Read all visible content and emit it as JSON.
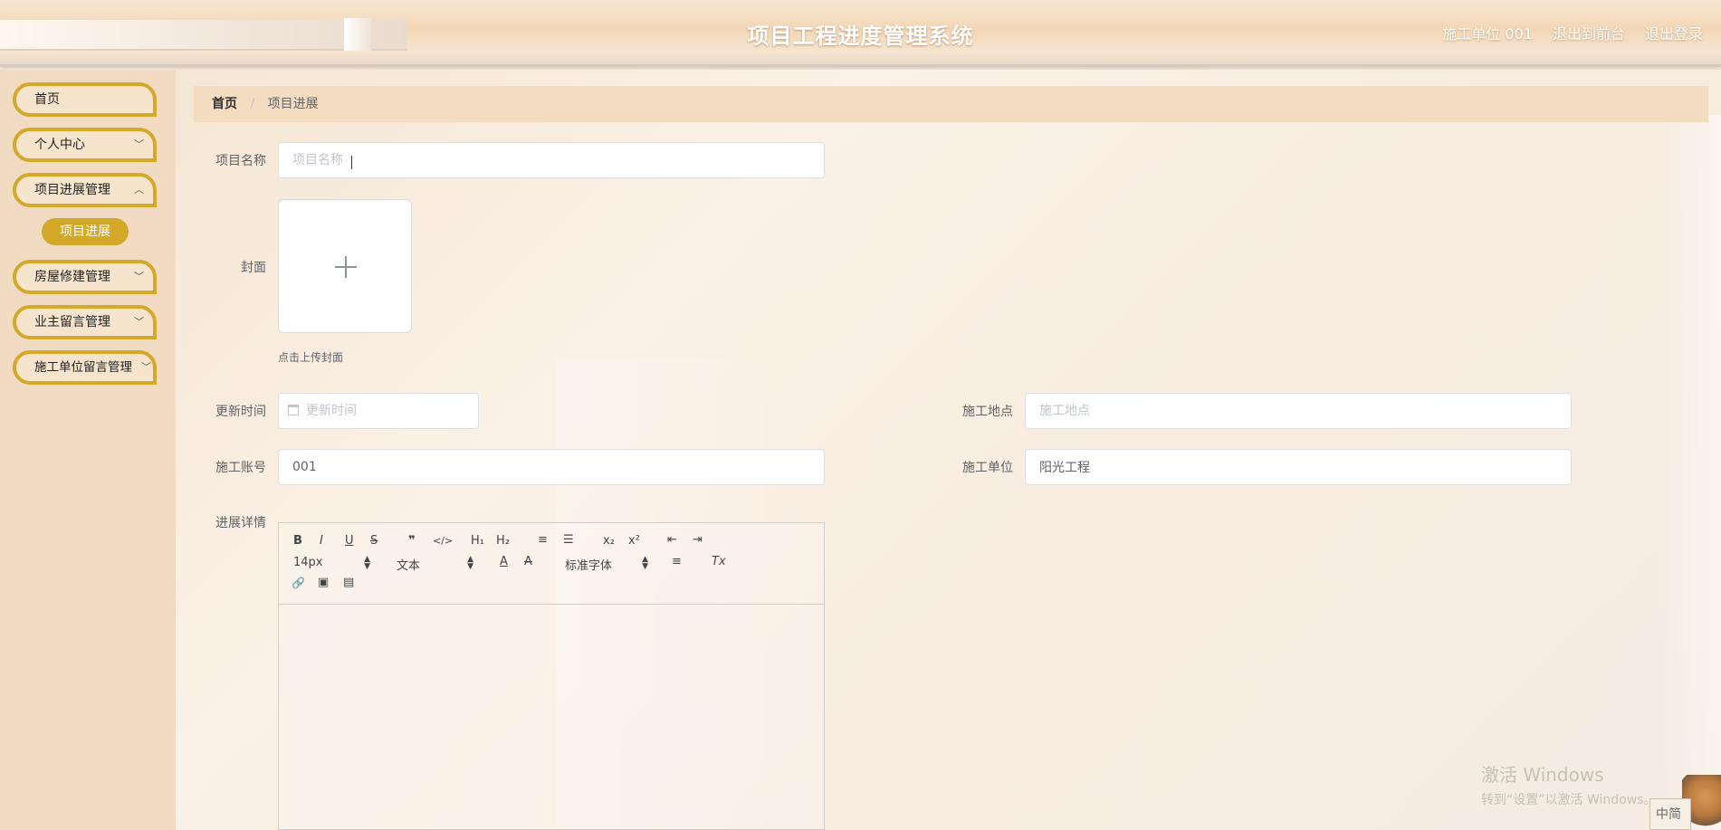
{
  "header": {
    "title": "项目工程进度管理系统",
    "user": "施工单位 001",
    "back_to_front": "退出到前台",
    "logout": "退出登录"
  },
  "sidebar": {
    "items": [
      {
        "label": "首页",
        "has_chevron": false
      },
      {
        "label": "个人中心",
        "has_chevron": true
      },
      {
        "label": "项目进展管理",
        "has_chevron": true
      },
      {
        "label": "房屋修建管理",
        "has_chevron": true
      },
      {
        "label": "业主留言管理",
        "has_chevron": true
      },
      {
        "label": "施工单位留言管理",
        "has_chevron": true
      }
    ],
    "active_submenu": "项目进展"
  },
  "breadcrumb": {
    "home": "首页",
    "separator": "/",
    "current": "项目进展"
  },
  "form": {
    "project_name": {
      "label": "项目名称",
      "placeholder": "项目名称",
      "value": ""
    },
    "cover": {
      "label": "封面",
      "tip": "点击上传封面"
    },
    "update_time": {
      "label": "更新时间",
      "placeholder": "更新时间",
      "value": ""
    },
    "site": {
      "label": "施工地点",
      "placeholder": "施工地点",
      "value": ""
    },
    "account": {
      "label": "施工账号",
      "value": "001"
    },
    "unit": {
      "label": "施工单位",
      "value": "阳光工程"
    },
    "details": {
      "label": "进展详情"
    }
  },
  "editor": {
    "font_size": "14px",
    "header_type": "文本",
    "font_family": "标准字体",
    "buttons": {
      "bold": "B",
      "italic": "I",
      "underline": "U",
      "strike": "S",
      "blockquote": "❞",
      "code": "</>",
      "h1": "H₁",
      "h2": "H₂",
      "ordered_list": "≡",
      "bullet_list": "☰",
      "sub": "x₂",
      "sup": "x²",
      "indent_minus": "⇤",
      "indent_plus": "⇥",
      "color": "A",
      "background": "A",
      "align": "≡",
      "clean": "Tx",
      "link": "🔗",
      "image": "▣",
      "video": "▤"
    }
  },
  "watermark": {
    "line1": "激活 Windows",
    "line2": "转到“设置”以激活 Windows。"
  },
  "ime": "中简"
}
